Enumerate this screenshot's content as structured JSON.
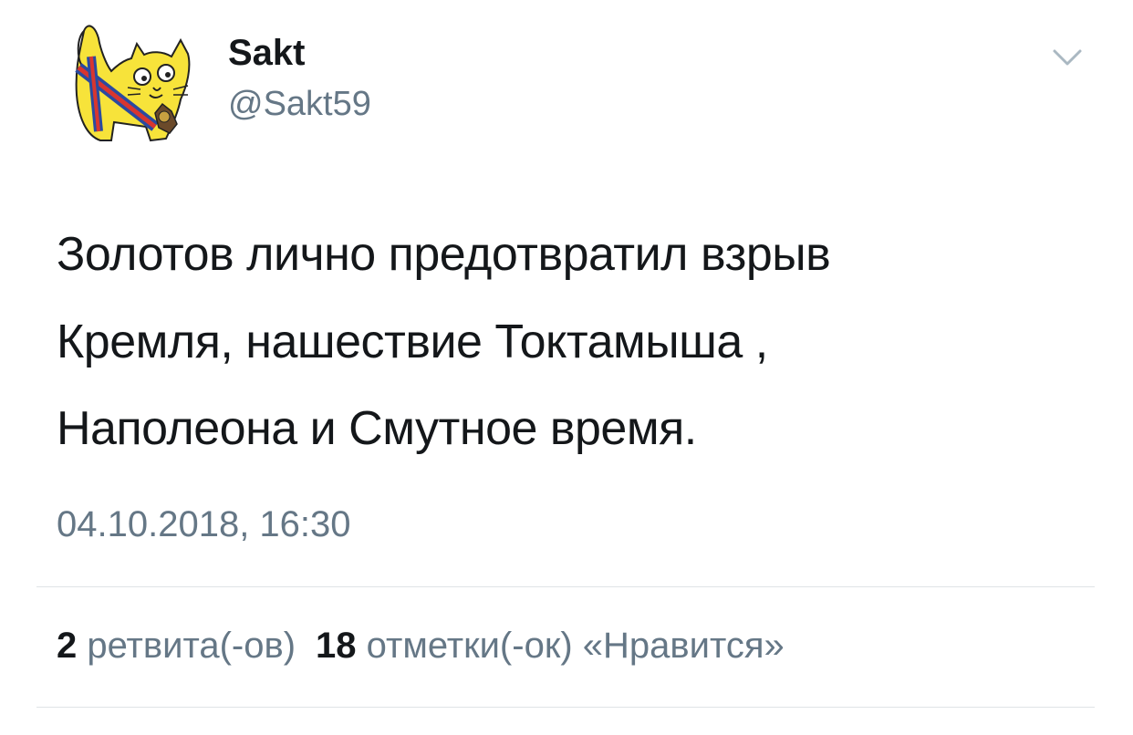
{
  "author": {
    "name": "Sakt",
    "handle": "@Sakt59",
    "avatar_icon": "yellow-cat-avatar-icon"
  },
  "menu_icon": "chevron-down-icon",
  "tweet": {
    "lines": [
      "Золотов лично предотвратил взрыв",
      "Кремля, нашествие Токтамыша ,",
      "Наполеона и Смутное время."
    ],
    "timestamp": "04.10.2018, 16:30"
  },
  "stats": {
    "retweets_count": "2",
    "retweets_label": "ретвита(-ов)",
    "likes_count": "18",
    "likes_label": "отметки(-ок) «Нравится»"
  },
  "colors": {
    "text_primary": "#14171a",
    "text_secondary": "#657786",
    "divider": "#dfe3e6",
    "avatar_yellow": "#f7e33a",
    "avatar_stripe_red": "#d8362f",
    "avatar_stripe_blue": "#2a4aa0"
  }
}
